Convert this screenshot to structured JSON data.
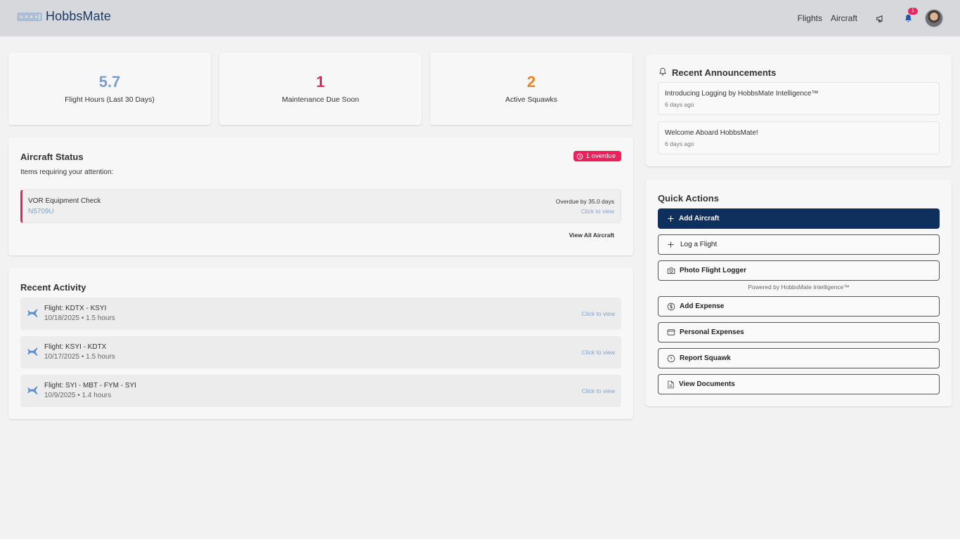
{
  "header": {
    "brand": "HobbsMate",
    "nav": {
      "flights": "Flights",
      "aircraft": "Aircraft"
    },
    "notification_count": "1",
    "icons": [
      "logo-icon",
      "megaphone-icon",
      "bell-icon",
      "avatar"
    ]
  },
  "stats": [
    {
      "value": "5.7",
      "label": "Flight Hours (Last 30 Days)",
      "color": "#7a9fc9"
    },
    {
      "value": "1",
      "label": "Maintenance Due Soon",
      "color": "#e8265f"
    },
    {
      "value": "2",
      "label": "Active Squawks",
      "color": "#f0821a"
    }
  ],
  "aircraft_status": {
    "title": "Aircraft Status",
    "badge": "1 overdue",
    "subtitle": "Items requiring your attention:",
    "item": {
      "name": "VOR Equipment Check",
      "tail": "N5709U",
      "status": "Overdue by 35.0 days",
      "link": "Click to view"
    },
    "view_all": "View All Aircraft"
  },
  "recent_activity": {
    "title": "Recent Activity",
    "items": [
      {
        "title": "Flight: KDTX - KSYI",
        "sub": "10/18/2025 • 1.5 hours",
        "link": "Click to view"
      },
      {
        "title": "Flight: KSYI - KDTX",
        "sub": "10/17/2025 • 1.5 hours",
        "link": "Click to view"
      },
      {
        "title": "Flight: SYI - MBT - FYM - SYI",
        "sub": "10/9/2025 • 1.4 hours",
        "link": "Click to view"
      }
    ]
  },
  "announcements": {
    "title": "Recent Announcements",
    "items": [
      {
        "title": "Introducing Logging by HobbsMate Intelligence™",
        "time": "6 days ago"
      },
      {
        "title": "Welcome Aboard HobbsMate!",
        "time": "6 days ago"
      }
    ]
  },
  "quick_actions": {
    "title": "Quick Actions",
    "add_aircraft": "Add Aircraft",
    "log_flight": "Log a Flight",
    "photo_logger": "Photo Flight Logger",
    "powered": "Powered by HobbsMate Intelligence™",
    "add_expense": "Add Expense",
    "personal_expenses": "Personal Expenses",
    "report_squawk": "Report Squawk",
    "view_documents": "View Documents"
  },
  "colors": {
    "primary": "#0f2f5c",
    "danger": "#ef1f5b",
    "link": "#7ea3cf"
  }
}
